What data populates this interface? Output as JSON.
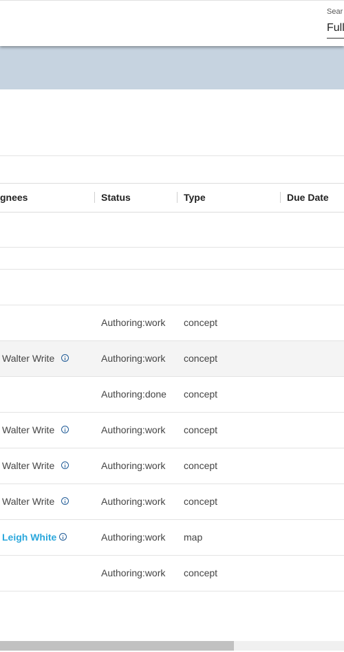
{
  "search": {
    "label": "Sear",
    "value": "Full"
  },
  "columns": [
    "gnees",
    "Status",
    "Type",
    "Due Date"
  ],
  "rows": [
    {
      "assignee": "",
      "status": "",
      "type": ""
    },
    {
      "assignee": "",
      "status": "",
      "type": ""
    },
    {
      "assignee": "",
      "status": "",
      "type": ""
    },
    {
      "assignee": "",
      "status": "Authoring:work",
      "type": "concept"
    },
    {
      "assignee": "Walter Write",
      "status": "Authoring:work",
      "type": "concept"
    },
    {
      "assignee": "",
      "status": "Authoring:done",
      "type": "concept"
    },
    {
      "assignee": "Walter Write",
      "status": "Authoring:work",
      "type": "concept"
    },
    {
      "assignee": "Walter Write",
      "status": "Authoring:work",
      "type": "concept"
    },
    {
      "assignee": "Walter Write",
      "status": "Authoring:work",
      "type": "concept"
    },
    {
      "assignee": "Leigh White",
      "status": "Authoring:work",
      "type": "map"
    },
    {
      "assignee": "",
      "status": "Authoring:work",
      "type": "concept"
    }
  ],
  "colors": {
    "band": "#c6d3e0",
    "link": "#2aa7dc",
    "info_icon": "#1f5a96"
  },
  "icons": {
    "info": "info-icon"
  }
}
